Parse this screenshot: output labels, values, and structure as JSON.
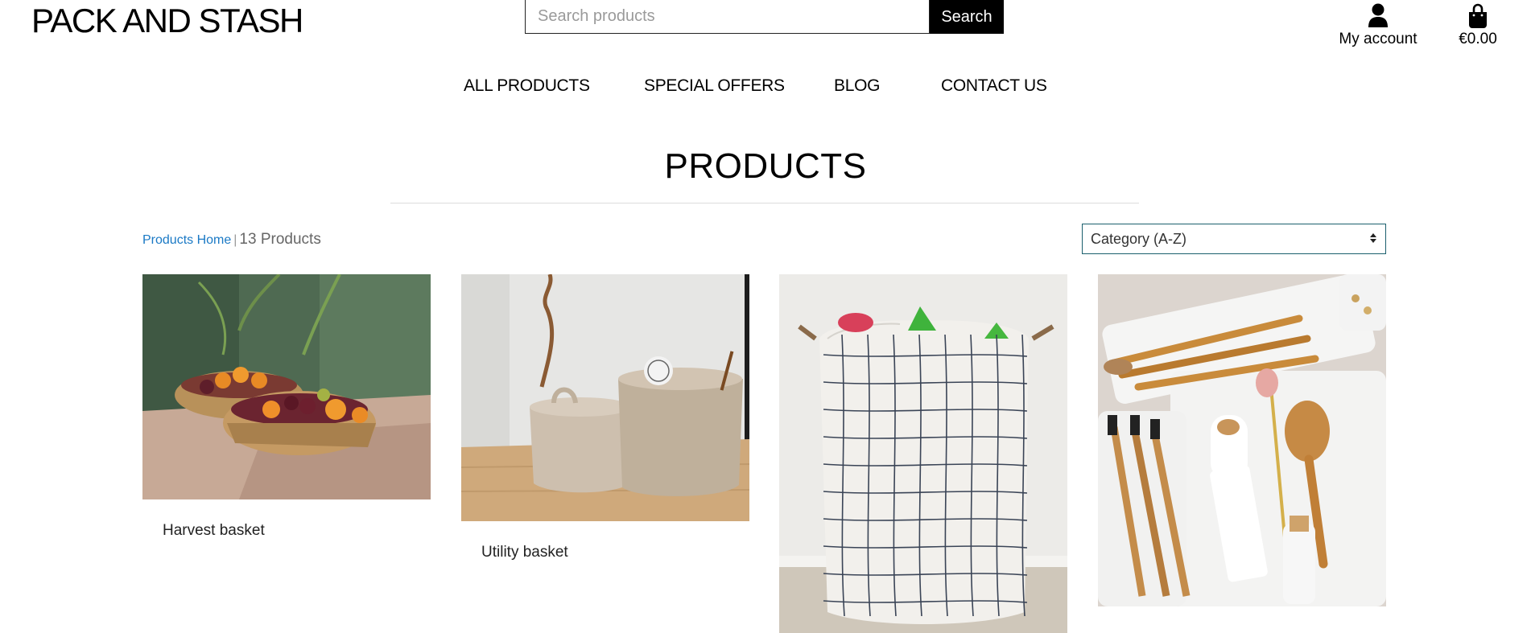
{
  "header": {
    "logo": "PACK AND STASH",
    "search_placeholder": "Search products",
    "search_button": "Search",
    "account_label": "My account",
    "account_icon": "user-icon",
    "cart_total": "€0.00",
    "cart_icon": "shopping-bag-icon"
  },
  "nav": {
    "items": [
      "ALL PRODUCTS",
      "SPECIAL OFFERS",
      "BLOG",
      "CONTACT US"
    ]
  },
  "page": {
    "title": "PRODUCTS",
    "breadcrumb_link": "Products Home",
    "separator": "|",
    "product_count": "13 Products",
    "sort_selected": "Category (A-Z)"
  },
  "products": [
    {
      "name": "Harvest basket",
      "image": "baskets-of-fruit-photo"
    },
    {
      "name": "Utility basket",
      "image": "rope-baskets-photo"
    },
    {
      "name": "",
      "image": "grid-laundry-hamper-photo"
    },
    {
      "name": "",
      "image": "drawer-organiser-photo"
    }
  ],
  "colors": {
    "link": "#1a79c5",
    "button_bg": "#000000",
    "sort_border": "#1b5f6d"
  }
}
